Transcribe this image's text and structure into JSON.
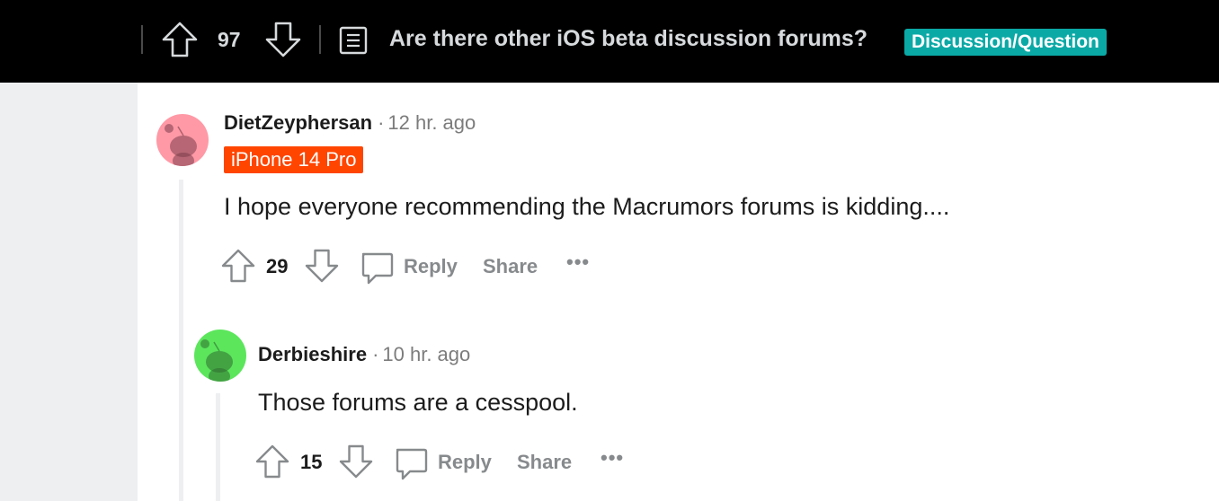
{
  "header": {
    "vote_count": "97",
    "post_title": "Are there other iOS beta discussion forums?",
    "post_flair": "Discussion/Question"
  },
  "comments": [
    {
      "author": "DietZeyphersan",
      "separator": "·",
      "time": "12 hr. ago",
      "user_flair": "iPhone 14 Pro",
      "body": "I hope everyone recommending the Macrumors forums is kidding....",
      "votes": "29",
      "reply_label": "Reply",
      "share_label": "Share",
      "more_label": "•••",
      "avatar_color": "#ff99a6"
    },
    {
      "author": "Derbieshire",
      "separator": "·",
      "time": "10 hr. ago",
      "body": "Those forums are a cesspool.",
      "votes": "15",
      "reply_label": "Reply",
      "share_label": "Share",
      "more_label": "•••",
      "avatar_color": "#5ce65c"
    }
  ],
  "colors": {
    "post_flair_bg": "#0aa9a6",
    "user_flair_bg": "#ff4500",
    "topbar_bg": "#000000"
  },
  "icons": [
    "upvote-icon",
    "downvote-icon",
    "post-text-icon",
    "comment-bubble-icon",
    "snoo-avatar-icon"
  ]
}
